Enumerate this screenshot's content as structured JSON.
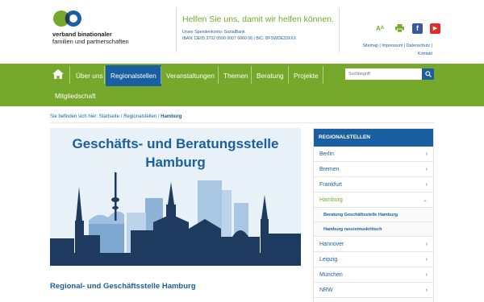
{
  "header": {
    "logo_line1": "verband binationaler",
    "logo_line2": "familien und partnerschaften",
    "slogan": "Helfen Sie uns, damit wir helfen können.",
    "donate_line1": "Unser Spendenkonto: SozialBank",
    "donate_line2": "IBAN: DE05 3702 0500 0007 6060 06 | BIC: BFSWDE33XXX",
    "icons": [
      "text-size-icon",
      "print-icon",
      "facebook-icon",
      "youtube-icon"
    ],
    "meta_links_line1": "Sitemap | Impressum | Datenschutz |",
    "meta_links_line2": "Kontakt"
  },
  "nav": {
    "items": [
      "Über uns",
      "Regionalstellen",
      "Veranstaltungen",
      "Themen",
      "Beratung",
      "Projekte",
      "Mitgliedschaft"
    ],
    "active": "Regionalstellen",
    "search_placeholder": "Suchbegriff"
  },
  "breadcrumb": {
    "prefix": "Sie befinden sich hier:",
    "items": [
      "Startseite",
      "Regionalstellen"
    ],
    "current": "Hamburg"
  },
  "hero": {
    "title_line1": "Geschäfts- und Beratungsstelle",
    "title_line2": "Hamburg"
  },
  "main": {
    "subheading": "Regional- und Geschäftsstelle Hamburg"
  },
  "sidebar": {
    "heading": "REGIONALSTELLEN",
    "items": [
      "Berlin",
      "Bremen",
      "Frankfurt",
      "Hamburg",
      "Hannover",
      "Leipzig",
      "München",
      "NRW"
    ],
    "open": "Hamburg",
    "sub_items": [
      "Beratung Geschäftsstelle Hamburg",
      "Hamburg rassismuskritisch"
    ]
  },
  "colors": {
    "green": "#76a82c",
    "blue": "#1a5f9f",
    "dark": "#223d5a"
  }
}
